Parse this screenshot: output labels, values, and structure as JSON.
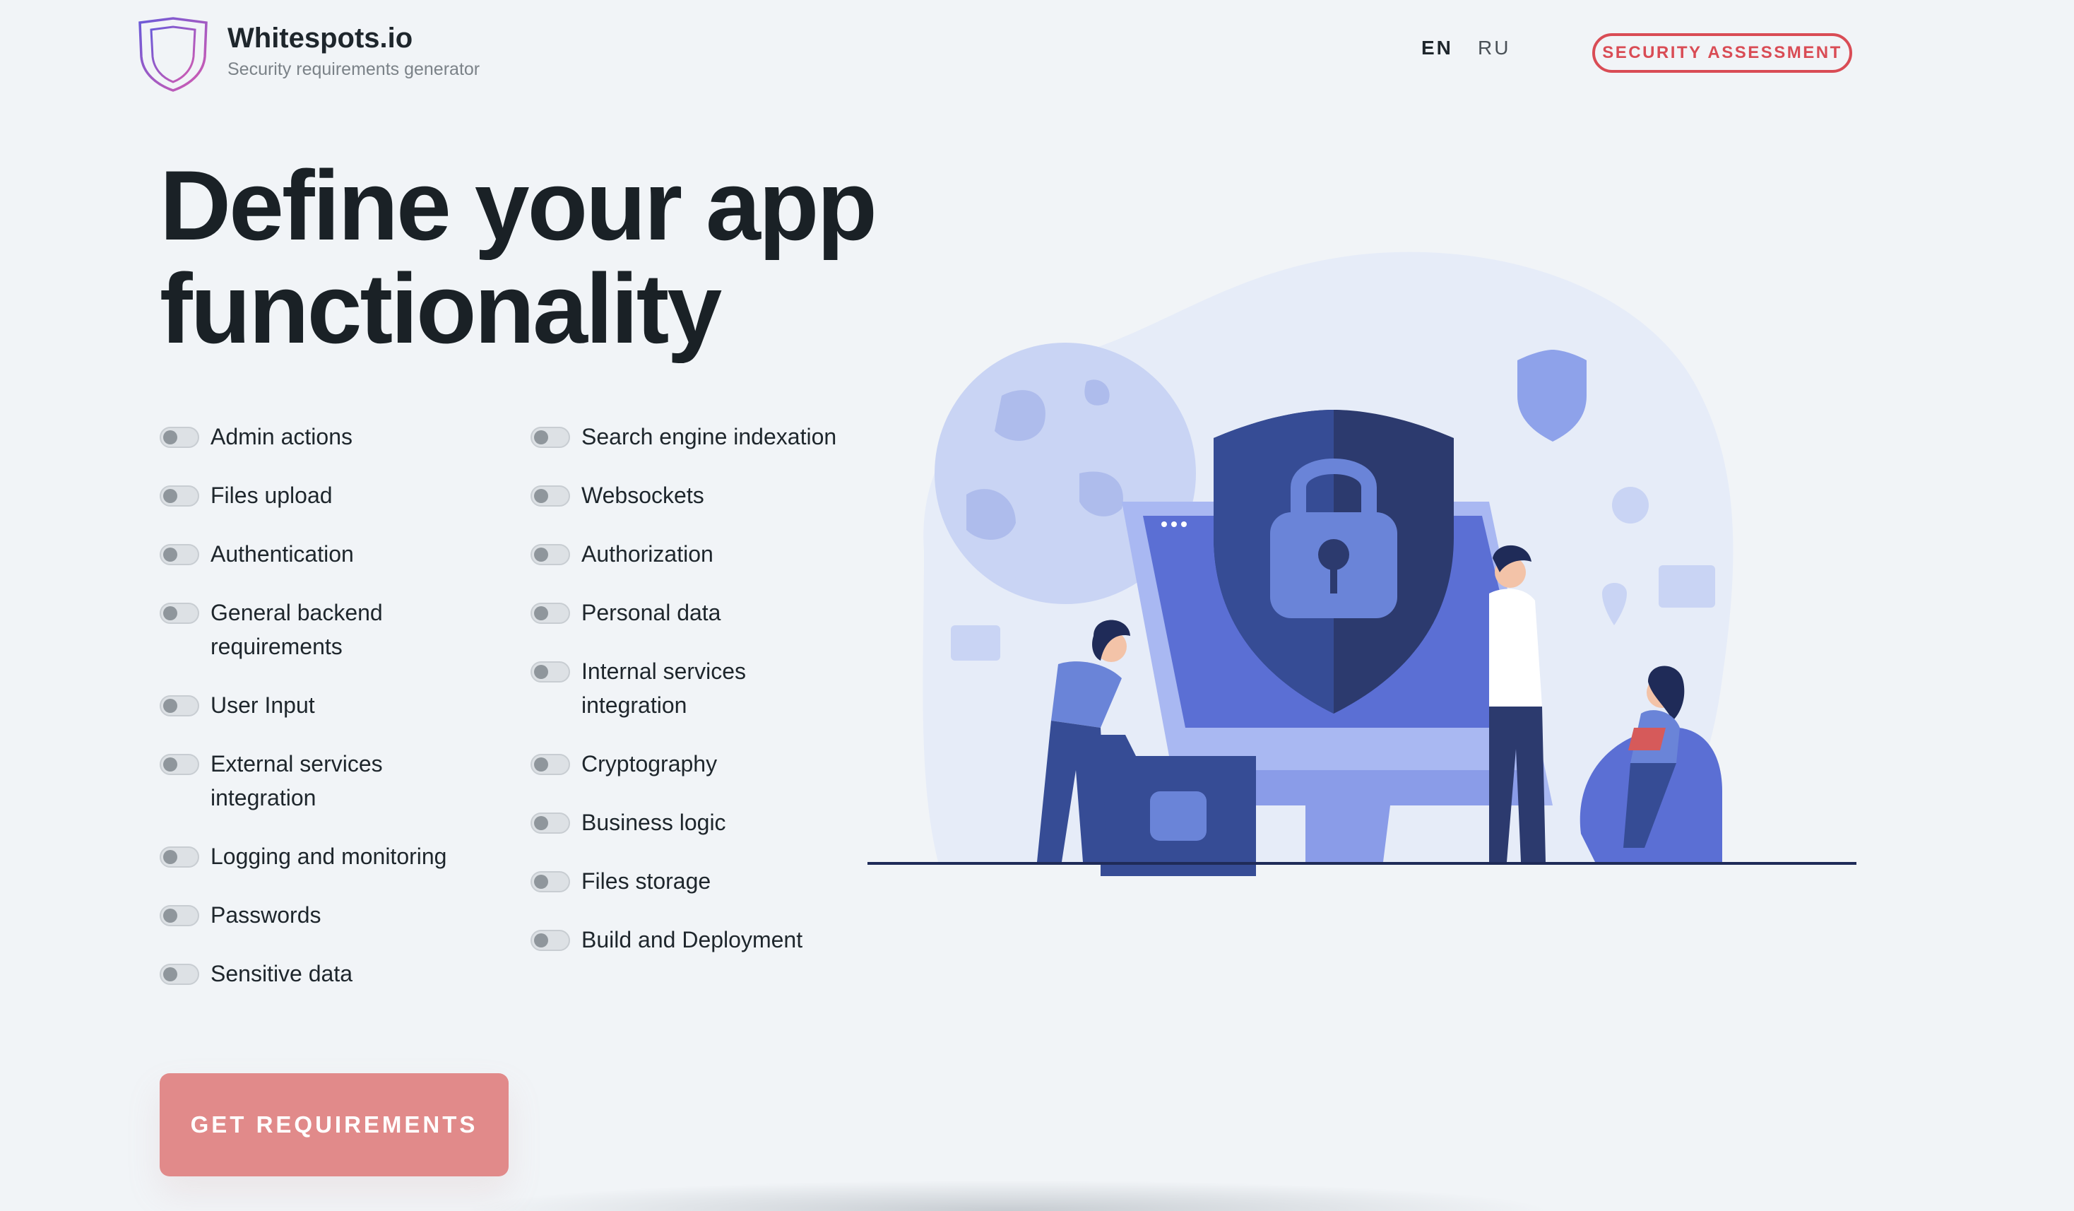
{
  "header": {
    "brand_name": "Whitespots.io",
    "brand_tagline": "Security requirements generator",
    "languages": [
      {
        "code": "EN",
        "active": true
      },
      {
        "code": "RU",
        "active": false
      }
    ],
    "cta_label": "SECURITY ASSESSMENT"
  },
  "hero": {
    "title_line1": "Define your app",
    "title_line2": "functionality"
  },
  "features": {
    "left": [
      {
        "label": "Admin actions",
        "checked": false
      },
      {
        "label": "Files upload",
        "checked": false
      },
      {
        "label": "Authentication",
        "checked": false
      },
      {
        "label": "General backend requirements",
        "checked": false
      },
      {
        "label": "User Input",
        "checked": false
      },
      {
        "label": "External services integration",
        "checked": false
      },
      {
        "label": "Logging and monitoring",
        "checked": false
      },
      {
        "label": "Passwords",
        "checked": false
      },
      {
        "label": "Sensitive data",
        "checked": false
      }
    ],
    "right": [
      {
        "label": "Search engine indexation",
        "checked": false
      },
      {
        "label": "Websockets",
        "checked": false
      },
      {
        "label": "Authorization",
        "checked": false
      },
      {
        "label": "Personal data",
        "checked": false
      },
      {
        "label": "Internal services integration",
        "checked": false
      },
      {
        "label": "Cryptography",
        "checked": false
      },
      {
        "label": "Business logic",
        "checked": false
      },
      {
        "label": "Files storage",
        "checked": false
      },
      {
        "label": "Build and Deployment",
        "checked": false
      }
    ]
  },
  "submit_label": "GET REQUIREMENTS",
  "colors": {
    "background": "#f1f4f7",
    "accent": "#d94c55",
    "button": "#e18a8a",
    "illustration_dark": "#2c3a6e",
    "illustration_mid": "#5b6fd4",
    "illustration_light": "#a9b8f2"
  }
}
